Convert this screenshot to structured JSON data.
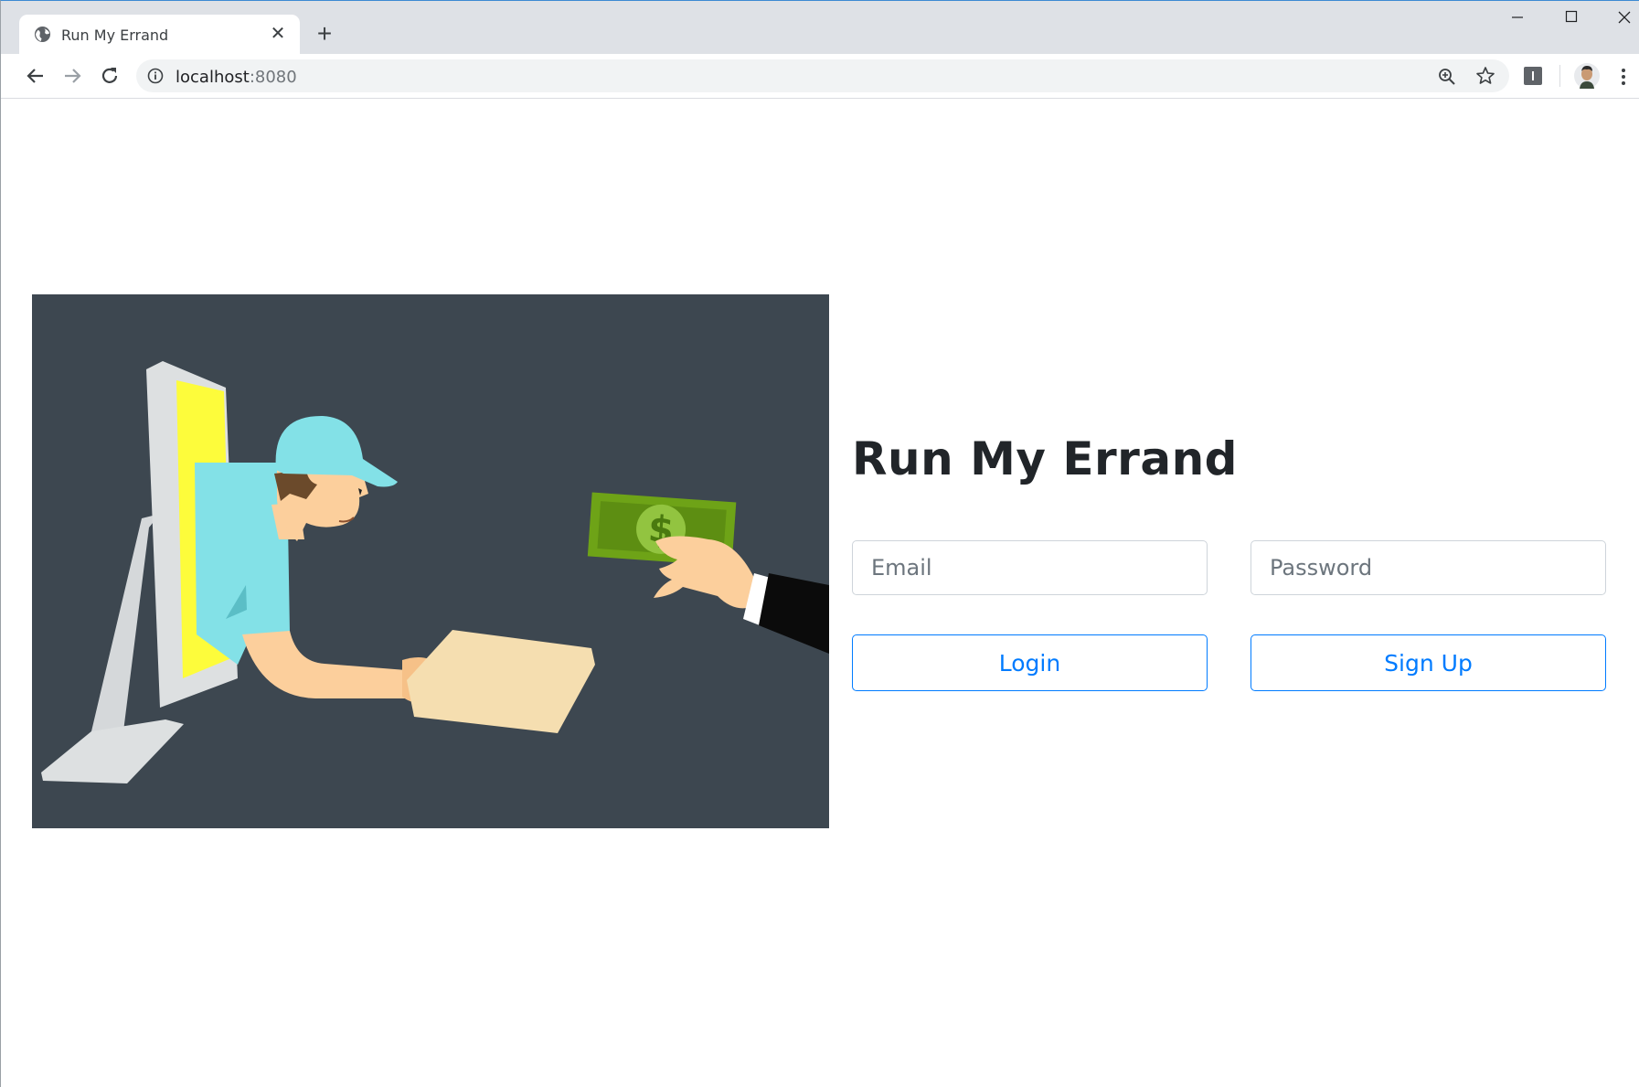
{
  "browser": {
    "tab_title": "Run My Errand",
    "tab_close": "✕",
    "new_tab": "+",
    "url_host": "localhost",
    "url_port": ":8080"
  },
  "page": {
    "title": "Run My Errand",
    "email_placeholder": "Email",
    "password_placeholder": "Password",
    "login_label": "Login",
    "signup_label": "Sign Up"
  },
  "hero": {
    "currency_symbol": "$",
    "colors": {
      "background": "#3d4750",
      "cap": "#83e1e7",
      "screen": "#fdfc3b",
      "monitor": "#dde0e1",
      "skin": "#fccf9c",
      "package": "#f5deb0",
      "money": "#6ea317"
    }
  },
  "colors": {
    "primary": "#007bff",
    "title_text": "#212529",
    "tabstrip": "#dee1e6"
  }
}
